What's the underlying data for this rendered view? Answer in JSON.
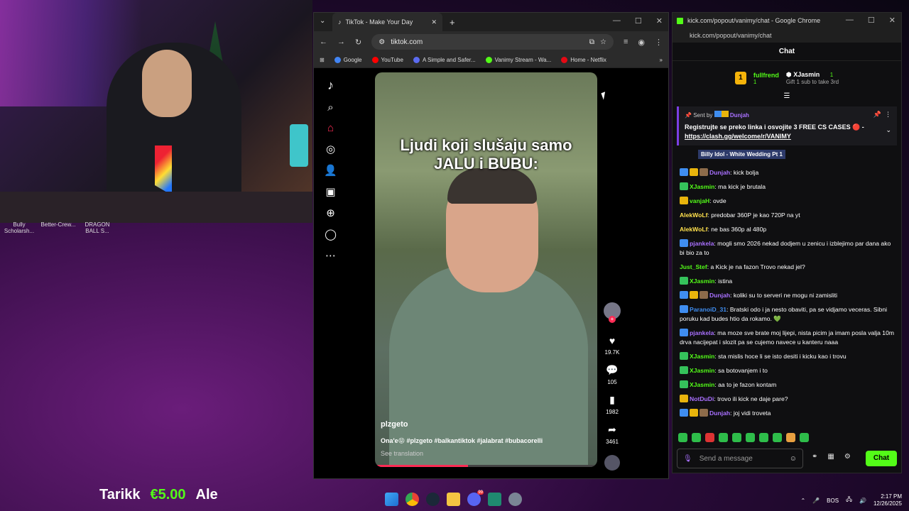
{
  "webcam": {
    "labels": [
      "Bully Scholarsh...",
      "Better-Crew...",
      "DRAGON BALL S..."
    ]
  },
  "tiktok_browser": {
    "tab_title": "TikTok - Make Your Day",
    "url": "tiktok.com",
    "bookmarks": [
      {
        "label": "Google",
        "color": "#4285f4"
      },
      {
        "label": "YouTube",
        "color": "#ff0000"
      },
      {
        "label": "A Simple and Safer...",
        "color": "#5b6bf0"
      },
      {
        "label": "Vanimy Stream - Wa...",
        "color": "#53fc18"
      },
      {
        "label": "Home - Netflix",
        "color": "#e50914"
      }
    ],
    "video": {
      "caption_line1": "Ljudi koji slušaju samo",
      "caption_line2": "JALU i BUBU:",
      "username": "plzgeto",
      "description": "Ona'e😝 #plzgeto #balkantiktok #jalabrat #bubacorelli",
      "see_translation": "See translation",
      "progress": 0.42
    },
    "actions": {
      "likes": "19.7K",
      "comments": "105",
      "saves": "1982",
      "shares": "3461"
    }
  },
  "kick": {
    "window_title": "kick.com/popout/vanimy/chat - Google Chrome",
    "url": "kick.com/popout/vanimy/chat",
    "chat_title": "Chat",
    "leaderboard": {
      "rank": "1",
      "first_name": "fullfrend",
      "first_count": "1",
      "second_name": "XJasmin",
      "second_count": "1",
      "gift_text": "Gift 1 sub to take 3rd"
    },
    "pinned": {
      "sent_by": "Sent by",
      "sender": "Dunjah",
      "message": "Registrujte se preko linka i osvojite 3 FREE CS CASES 🔴 -",
      "link": "https://clash.gg/welcome/r/VANIMY"
    },
    "now_playing": "Billy Idol - White Wedding Pt 1",
    "messages": [
      {
        "badges": [
          "blue",
          "gold",
          "brown"
        ],
        "user": "Dunjah",
        "color": "#a970ff",
        "text": ": kick bolja"
      },
      {
        "badges": [
          "green"
        ],
        "user": "XJasmin",
        "color": "#53fc18",
        "text": ": ma kick je brutala"
      },
      {
        "badges": [
          "gold"
        ],
        "user": "vanjaH",
        "color": "#53fc18",
        "text": ": ovde"
      },
      {
        "badges": [],
        "user": "AlekWoLf",
        "color": "#ffe14d",
        "text": ": predobar 360P je kao 720P na yt"
      },
      {
        "badges": [],
        "user": "AlekWoLf",
        "color": "#ffe14d",
        "text": ": ne bas 360p al 480p"
      },
      {
        "badges": [
          "blue"
        ],
        "user": "pjankela",
        "color": "#a970ff",
        "text": ": mogli smo 2026 nekad dodjem u zenicu i izblejimo par dana ako bi bio za to"
      },
      {
        "badges": [],
        "user": "Just_Stef",
        "color": "#53fc18",
        "text": ": a Kick je na fazon Trovo nekad jel?"
      },
      {
        "badges": [
          "green"
        ],
        "user": "XJasmin",
        "color": "#53fc18",
        "text": ": istina"
      },
      {
        "badges": [
          "blue",
          "gold",
          "brown"
        ],
        "user": "Dunjah",
        "color": "#a970ff",
        "text": ": koliki su to serveri ne mogu ni zamisliti"
      },
      {
        "badges": [
          "blue"
        ],
        "user": "ParanoiD_31",
        "color": "#3f8df0",
        "text": ": Bratski odo i ja nesto obaviti, pa se vidjamo veceras. Sibni poruku kad budes htio da rokamo. 💚"
      },
      {
        "badges": [
          "blue"
        ],
        "user": "pjankela",
        "color": "#a970ff",
        "text": ": ma moze sve brate moj lijepi, nista picim ja imam posla valja 10m drva nacijepat i slozit pa se cujemo navece u kanteru naaa"
      },
      {
        "badges": [
          "green"
        ],
        "user": "XJasmin",
        "color": "#53fc18",
        "text": ": sta mislis hoce li se isto desiti i kicku kao i trovu"
      },
      {
        "badges": [
          "green"
        ],
        "user": "XJasmin",
        "color": "#53fc18",
        "text": ": sa botovanjem i to"
      },
      {
        "badges": [
          "green"
        ],
        "user": "XJasmin",
        "color": "#53fc18",
        "text": ": aa to je fazon kontam"
      },
      {
        "badges": [
          "gold"
        ],
        "user": "NotDuDi",
        "color": "#a970ff",
        "text": ": trovo ili kick ne daje pare?"
      },
      {
        "badges": [
          "blue",
          "gold",
          "brown"
        ],
        "user": "Dunjah",
        "color": "#a970ff",
        "text": ": joj vidi troveta"
      }
    ],
    "input_placeholder": "Send a message",
    "chat_button": "Chat"
  },
  "ticker": {
    "name1": "Tarikk",
    "amount": "€5.00",
    "name2": "Ale"
  },
  "taskbar": {
    "language": "BOS",
    "time": "2:17 PM",
    "date": "12/26/2025"
  }
}
